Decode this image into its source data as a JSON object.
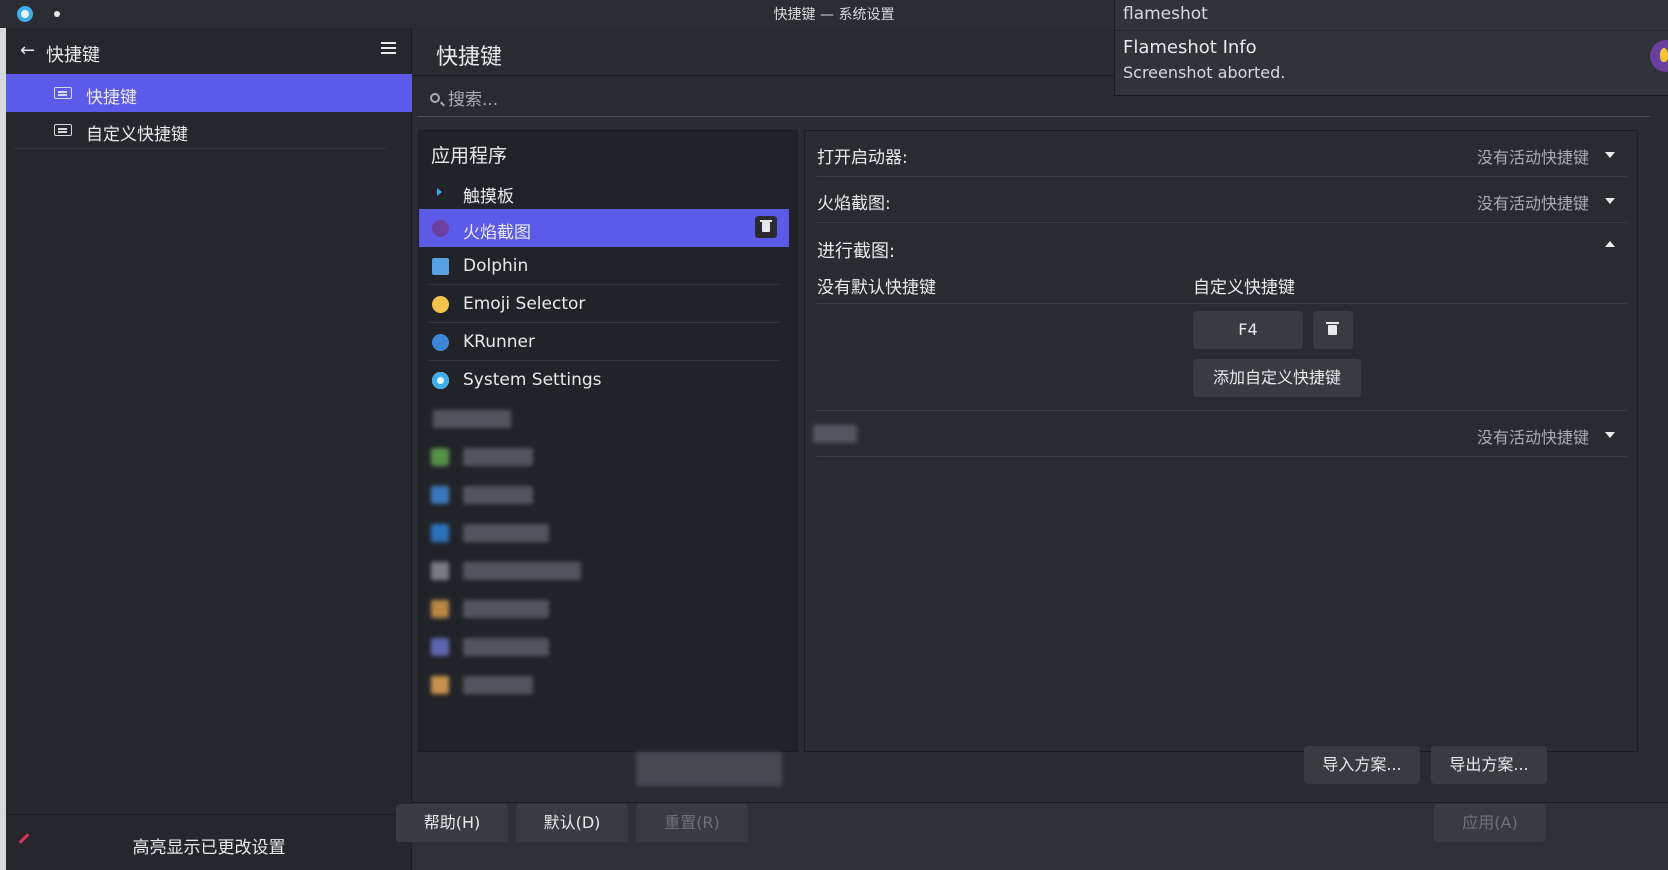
{
  "window": {
    "title": "快捷键 — 系统设置"
  },
  "sidebar": {
    "back_label": "←",
    "title": "快捷键",
    "items": [
      {
        "label": "快捷键",
        "active": true
      },
      {
        "label": "自定义快捷键",
        "active": false
      }
    ],
    "footer_label": "高亮显示已更改设置"
  },
  "main": {
    "title": "快捷键",
    "search_placeholder": "搜索..."
  },
  "apps": {
    "heading": "应用程序",
    "items": [
      {
        "name": "触摸板",
        "icon": "chevron-right-icon"
      },
      {
        "name": "火焰截图",
        "icon": "flameshot-icon",
        "selected": true
      },
      {
        "name": "Dolphin",
        "icon": "folder-icon"
      },
      {
        "name": "Emoji Selector",
        "icon": "emoji-icon"
      },
      {
        "name": "KRunner",
        "icon": "krunner-icon"
      },
      {
        "name": "System Settings",
        "icon": "settings-icon"
      }
    ]
  },
  "shortcuts": {
    "rows": [
      {
        "label": "打开启动器:",
        "value": "没有活动快捷键"
      },
      {
        "label": "火焰截图:",
        "value": "没有活动快捷键"
      }
    ],
    "expanded": {
      "label": "进行截图:",
      "default_header": "没有默认快捷键",
      "custom_header": "自定义快捷键",
      "custom_key": "F4",
      "add_button": "添加自定义快捷键"
    },
    "last_row_value": "没有活动快捷键"
  },
  "buttons": {
    "import": "导入方案...",
    "export": "导出方案...",
    "help": "帮助(H)",
    "defaults": "默认(D)",
    "reset": "重置(R)",
    "apply": "应用(A)"
  },
  "notification": {
    "app": "flameshot",
    "title": "Flameshot Info",
    "body": "Screenshot aborted."
  },
  "colors": {
    "accent": "#5c5ae8",
    "window_bg": "#2a2b31",
    "sidebar_bg": "#26272d"
  }
}
